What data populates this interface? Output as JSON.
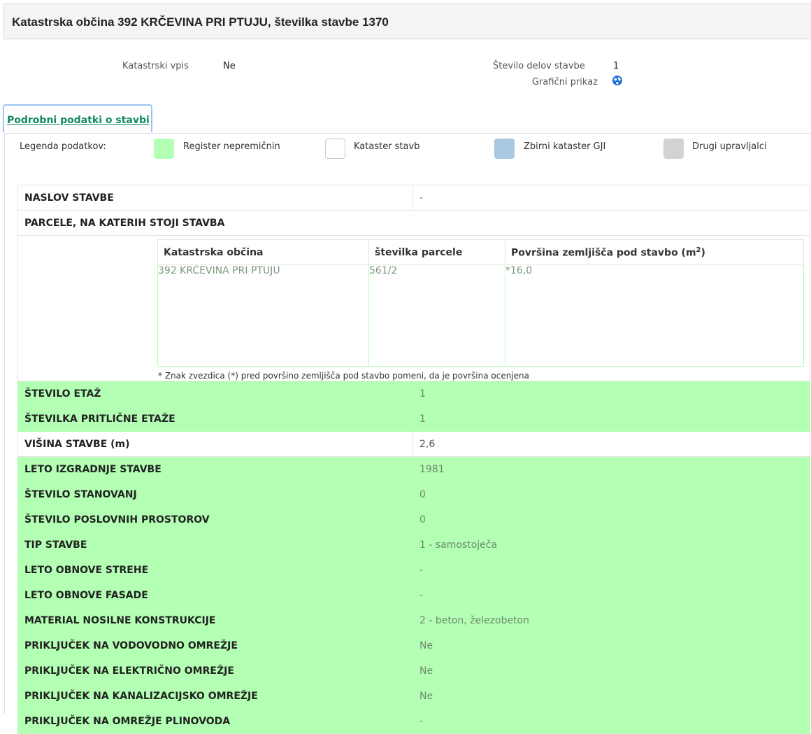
{
  "header": {
    "title": "Katastrska občina 392 KRČEVINA PRI PTUJU, številka stavbe 1370"
  },
  "info": {
    "katastrski_vpis_label": "Katastrski vpis",
    "katastrski_vpis_value": "Ne",
    "stevilo_delov_label": "Število delov stavbe",
    "stevilo_delov_value": "1",
    "graficni_prikaz_label": "Grafični prikaz",
    "graficni_prikaz_icon": "globe-icon"
  },
  "tab": {
    "label": "Podrobni podatki o stavbi"
  },
  "legend": {
    "title": "Legenda podatkov:",
    "items": [
      {
        "label": "Register nepremičnin",
        "color": "#b3ffb3"
      },
      {
        "label": "Kataster stavb",
        "color": "#ffffff"
      },
      {
        "label": "Zbirni kataster GJI",
        "color": "#aac8e0"
      },
      {
        "label": "Drugi upravljalci",
        "color": "#d2d2d2"
      }
    ]
  },
  "rows": {
    "naslov": {
      "label": "NASLOV STAVBE",
      "value": "-"
    },
    "parcele": {
      "label": "PARCELE, NA KATERIH STOJI STAVBA"
    },
    "stevilo_etaz": {
      "label": "ŠTEVILO ETAŽ",
      "value": "1"
    },
    "pritlicne_etaze": {
      "label": "ŠTEVILKA PRITLIČNE ETAŽE",
      "value": "1"
    },
    "visina": {
      "label": "VIŠINA STAVBE (m)",
      "value": "2,6"
    },
    "leto_izgradnje": {
      "label": "LETO IZGRADNJE STAVBE",
      "value": "1981"
    },
    "stanovanj": {
      "label": "ŠTEVILO STANOVANJ",
      "value": "0"
    },
    "poslovnih": {
      "label": "ŠTEVILO POSLOVNIH PROSTOROV",
      "value": "0"
    },
    "tip": {
      "label": "TIP STAVBE",
      "value": "1 - samostoječa"
    },
    "obnova_strehe": {
      "label": "LETO OBNOVE STREHE",
      "value": "-"
    },
    "obnova_fasade": {
      "label": "LETO OBNOVE FASADE",
      "value": "-"
    },
    "material": {
      "label": "MATERIAL NOSILNE KONSTRUKCIJE",
      "value": "2 - beton, železobeton"
    },
    "vodovod": {
      "label": "PRIKLJUČEK NA VODOVODNO OMREŽJE",
      "value": "Ne"
    },
    "elektrika": {
      "label": "PRIKLJUČEK NA ELEKTRIČNO OMREŽJE",
      "value": "Ne"
    },
    "kanalizacija": {
      "label": "PRIKLJUČEK NA KANALIZACIJSKO OMREŽJE",
      "value": "Ne"
    },
    "plinovod": {
      "label": "PRIKLJUČEK NA OMREŽJE PLINOVODA",
      "value": "-"
    }
  },
  "parcel_table": {
    "col_obcina": "Katastrska občina",
    "col_stevilka": "številka parcele",
    "col_povrsina": "Površina zemljišča pod stavbo (m",
    "col_povrsina_sup": "2",
    "col_povrsina_end": ")",
    "row": {
      "obcina": "392 KRČEVINA PRI PTUJU",
      "stevilka": "561/2",
      "povrsina": "*16,0"
    },
    "note": "* Znak zvezdica (*) pred površino zemljišča pod stavbo pomeni, da je površina ocenjena"
  }
}
